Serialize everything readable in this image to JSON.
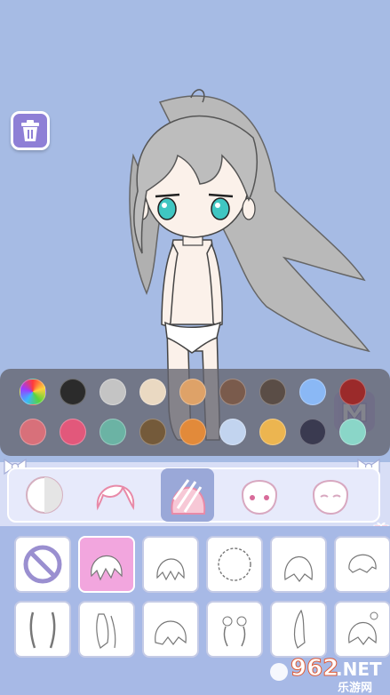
{
  "icons": {
    "trash": "trash-icon",
    "m_button": "m-logo-icon",
    "bow": "bow-icon",
    "gift": "gift-icon"
  },
  "palette": {
    "colors": [
      "rainbow",
      "#2b2b2b",
      "#c4c4c4",
      "#ead9c2",
      "#dea268",
      "#7a5b4c",
      "#5a4d46",
      "#8ab8f5",
      "#9b2a2a",
      "#d8707a",
      "#e2587b",
      "#6bb3a4",
      "#745a3a",
      "#e28a3a",
      "#c2d4ef",
      "#ecb550",
      "#3a3a50",
      "#8ad6c8"
    ]
  },
  "tabs": [
    {
      "name": "skin-tab",
      "active": false
    },
    {
      "name": "hair-front-tab",
      "active": false
    },
    {
      "name": "hair-back-tab",
      "active": true
    },
    {
      "name": "face-tab",
      "active": false
    },
    {
      "name": "head-tab",
      "active": false
    }
  ],
  "items": [
    {
      "name": "none-item",
      "selected": false
    },
    {
      "name": "hair-item-1",
      "selected": true
    },
    {
      "name": "hair-item-2",
      "selected": false
    },
    {
      "name": "hair-item-3",
      "selected": false
    },
    {
      "name": "hair-item-4",
      "selected": false
    },
    {
      "name": "hair-item-5",
      "selected": false
    },
    {
      "name": "hair-item-6",
      "selected": false
    },
    {
      "name": "hair-item-7",
      "selected": false
    },
    {
      "name": "hair-item-8",
      "selected": false
    },
    {
      "name": "hair-item-9",
      "selected": false
    },
    {
      "name": "hair-item-10",
      "selected": false
    },
    {
      "name": "hair-item-11",
      "selected": false
    }
  ],
  "watermark": {
    "number": "962",
    "suffix": ".NET",
    "subtitle": "乐游网"
  }
}
